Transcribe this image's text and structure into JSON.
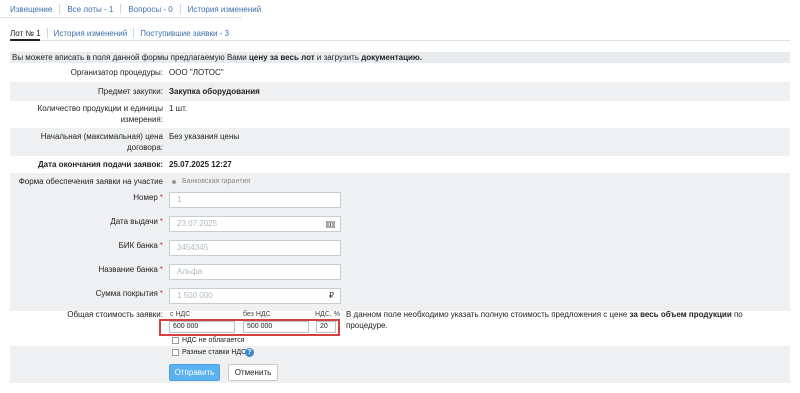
{
  "top_tabs": [
    {
      "label": "Извещение"
    },
    {
      "label": "Все лоты - 1"
    },
    {
      "label": "Вопросы - 0"
    },
    {
      "label": "История изменений"
    }
  ],
  "sub_tabs": [
    {
      "label": "Лот № 1"
    },
    {
      "label": "История изменений"
    },
    {
      "label": "Поступившие заявки - 3"
    }
  ],
  "notice": {
    "part1": "Вы можете вписать в поля данной формы предлагаемую Вами ",
    "bold1": "цену за весь лот",
    "part2": " и загрузить ",
    "bold2": "документацию."
  },
  "fields": {
    "organizer": {
      "label": "Организатор процедуры:",
      "value": "ООО \"ЛОТОС\""
    },
    "subject": {
      "label": "Предмет закупки:",
      "value": "Закупка оборудования"
    },
    "quantity": {
      "label_line1": "Количество продукции и единицы",
      "label_line2": "измерения:",
      "value": "1 шт."
    },
    "initial_price": {
      "label_line1": "Начальная (максимальная) цена",
      "label_line2": "договора:",
      "value": "Без указания цены"
    },
    "deadline": {
      "label": "Дата окончания подачи заявок:",
      "value": "25.07.2025 12:27"
    },
    "security_form": {
      "label": "Форма обеспечения заявки на участие",
      "option": "Банковская гарантия"
    },
    "number": {
      "label": "Номер",
      "value": "1"
    },
    "issue_date": {
      "label": "Дата выдачи",
      "value": "23.07.2025",
      "icon": "calendar-icon"
    },
    "bik": {
      "label": "БИК банка",
      "value": "3454345"
    },
    "bank_name": {
      "label": "Название банка",
      "value": "Альфа"
    },
    "coverage": {
      "label": "Сумма покрытия",
      "value": "1 500 000",
      "currency": "₽"
    },
    "required_mark": "*"
  },
  "price": {
    "label": "Общая стоимость заявки:",
    "with_vat_label": "с НДС",
    "without_vat_label": "без НДС",
    "vat_pct_label": "НДС, %",
    "with_vat_value": "600 000",
    "without_vat_value": "500 000",
    "vat_pct_value": "20",
    "hint_part1": "В данном поле необходимо указать полную стоимость предложения с цене ",
    "hint_bold": "за весь объем продукции",
    "hint_part2": " по процедуре.",
    "no_vat_label": "НДС не облагается",
    "diff_rates_label": "Разные ставки НДС",
    "help_glyph": "?"
  },
  "buttons": {
    "submit": "Отправить",
    "cancel": "Отменить"
  },
  "colors": {
    "link": "#3a6fb0",
    "highlight_border": "#d64040",
    "submit_button": "#5bb2f0",
    "required": "#d03030"
  }
}
